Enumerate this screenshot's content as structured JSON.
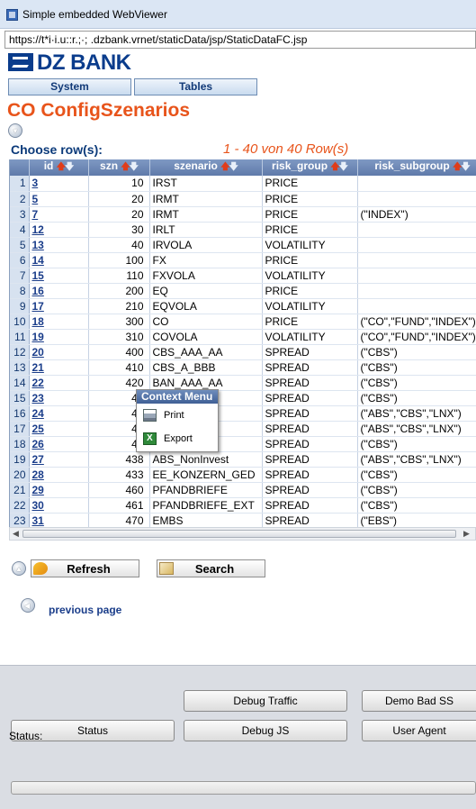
{
  "window": {
    "title": "Simple embedded WebViewer"
  },
  "url": "https://t*i·i.u::r.;·;  .dzbank.vrnet/staticData/jsp/StaticDataFC.jsp",
  "logo": {
    "text": "DZ BANK"
  },
  "nav": {
    "tabs": [
      "System",
      "Tables"
    ]
  },
  "page": {
    "title": "CO ConfigSzenarios",
    "choose_label": "Choose row(s):",
    "row_info": "1 - 40 von 40 Row(s)"
  },
  "table": {
    "columns": [
      "",
      "id",
      "szn",
      "szenario",
      "risk_group",
      "risk_subgroup"
    ],
    "rows": [
      [
        "1",
        "3",
        "10",
        "IRST",
        "PRICE",
        ""
      ],
      [
        "2",
        "5",
        "20",
        "IRMT",
        "PRICE",
        ""
      ],
      [
        "3",
        "7",
        "20",
        "IRMT",
        "PRICE",
        "(\"INDEX\")"
      ],
      [
        "4",
        "12",
        "30",
        "IRLT",
        "PRICE",
        ""
      ],
      [
        "5",
        "13",
        "40",
        "IRVOLA",
        "VOLATILITY",
        ""
      ],
      [
        "6",
        "14",
        "100",
        "FX",
        "PRICE",
        ""
      ],
      [
        "7",
        "15",
        "110",
        "FXVOLA",
        "VOLATILITY",
        ""
      ],
      [
        "8",
        "16",
        "200",
        "EQ",
        "PRICE",
        ""
      ],
      [
        "9",
        "17",
        "210",
        "EQVOLA",
        "VOLATILITY",
        ""
      ],
      [
        "10",
        "18",
        "300",
        "CO",
        "PRICE",
        "(\"CO\",\"FUND\",\"INDEX\")"
      ],
      [
        "11",
        "19",
        "310",
        "COVOLA",
        "VOLATILITY",
        "(\"CO\",\"FUND\",\"INDEX\")"
      ],
      [
        "12",
        "20",
        "400",
        "CBS_AAA_AA",
        "SPREAD",
        "(\"CBS\")"
      ],
      [
        "13",
        "21",
        "410",
        "CBS_A_BBB",
        "SPREAD",
        "(\"CBS\")"
      ],
      [
        "14",
        "22",
        "420",
        "BAN_AAA_AA",
        "SPREAD",
        "(\"CBS\")"
      ],
      [
        "15",
        "23",
        "43",
        "",
        "SPREAD",
        "(\"CBS\")"
      ],
      [
        "16",
        "24",
        "42",
        "",
        "SPREAD",
        "(\"ABS\",\"CBS\",\"LNX\")"
      ],
      [
        "17",
        "25",
        "43",
        "",
        "SPREAD",
        "(\"ABS\",\"CBS\",\"LNX\")"
      ],
      [
        "18",
        "26",
        "43",
        "N",
        "SPREAD",
        "(\"CBS\")"
      ],
      [
        "19",
        "27",
        "438",
        "ABS_NonInvest",
        "SPREAD",
        "(\"ABS\",\"CBS\",\"LNX\")"
      ],
      [
        "20",
        "28",
        "433",
        "EE_KONZERN_GED",
        "SPREAD",
        "(\"CBS\")"
      ],
      [
        "21",
        "29",
        "460",
        "PFANDBRIEFE",
        "SPREAD",
        "(\"CBS\")"
      ],
      [
        "22",
        "30",
        "461",
        "PFANDBRIEFE_EXT",
        "SPREAD",
        "(\"CBS\")"
      ],
      [
        "23",
        "31",
        "470",
        "EMBS",
        "SPREAD",
        "(\"EBS\")"
      ]
    ]
  },
  "context_menu": {
    "title": "Context Menu",
    "items": [
      {
        "label": "Print",
        "icon": "printer-icon"
      },
      {
        "label": "Export",
        "icon": "excel-icon"
      }
    ]
  },
  "actions": {
    "refresh_label": "Refresh",
    "search_label": "Search"
  },
  "pager": {
    "previous_label": "previous page"
  },
  "system_buttons": {
    "debug_traffic": "Debug Traffic",
    "demo_bad_ssl": "Demo Bad SS",
    "status": "Status",
    "debug_js": "Debug JS",
    "user_agent": "User Agent"
  },
  "status": {
    "label": "Status:",
    "progress": 0
  },
  "colors": {
    "accent": "#e8541b",
    "brand": "#0a3c8c",
    "header": "#6f8bba"
  }
}
